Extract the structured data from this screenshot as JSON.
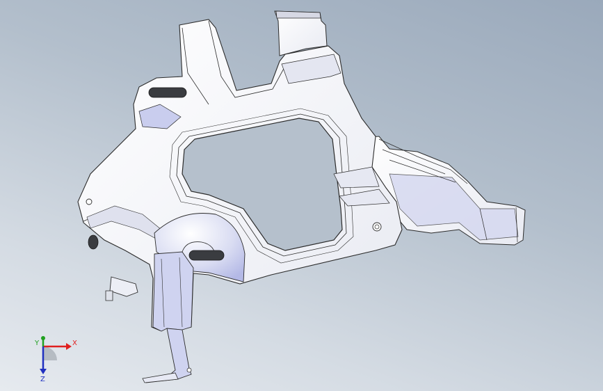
{
  "viewport": {
    "background_top": "#9aa9bb",
    "background_bottom": "#e6eaef"
  },
  "model": {
    "body_color": "#f4f5f8",
    "edge_color": "#2b2b2b",
    "shade_color": "#b9bee9",
    "slot_color": "#3a3c40"
  },
  "triad": {
    "x_label": "X",
    "y_label": "Y",
    "z_label": "Z",
    "x_color": "#e02020",
    "y_color": "#20a020",
    "z_color": "#2030c0"
  }
}
